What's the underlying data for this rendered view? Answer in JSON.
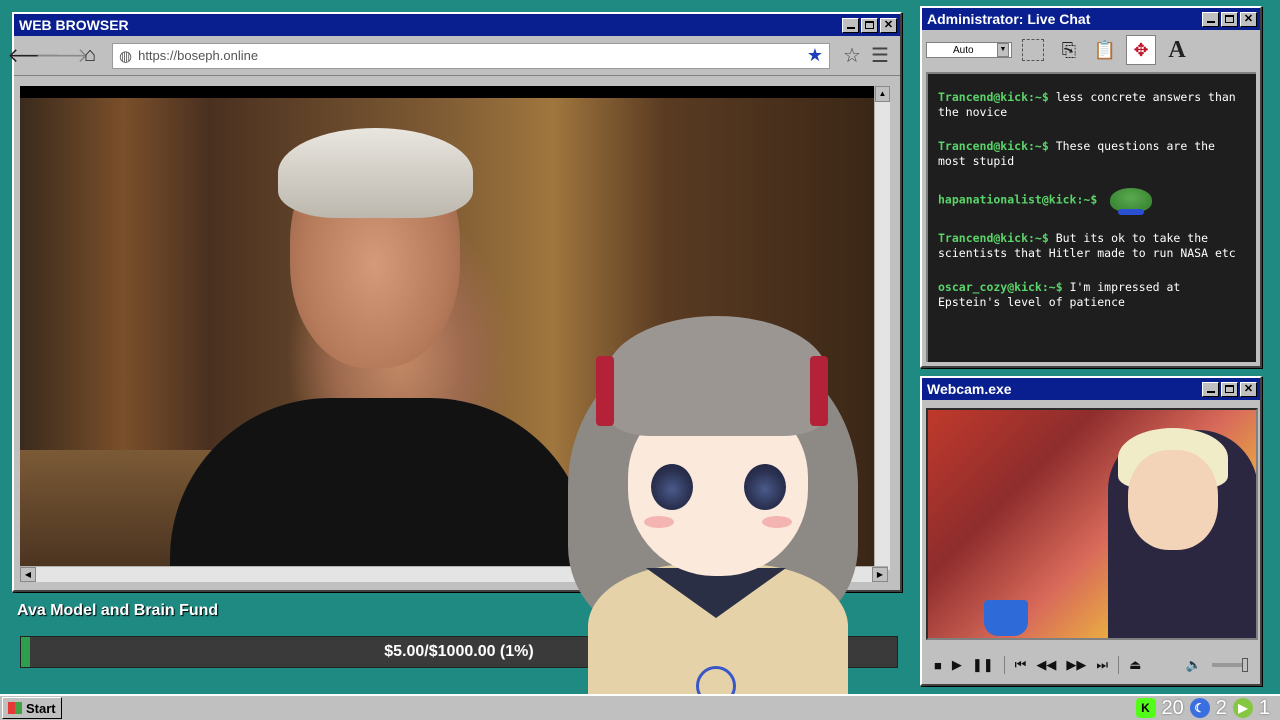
{
  "browser": {
    "title": "WEB BROWSER",
    "url": "https://boseph.online",
    "icons": {
      "back": "arrow-left-icon",
      "forward": "arrow-right-icon",
      "home": "home-icon",
      "globe": "globe-icon",
      "bookmarked": "star-filled-icon",
      "bookmark": "star-outline-icon",
      "menu": "hamburger-menu-icon"
    }
  },
  "fund": {
    "label": "Ava Model and Brain Fund",
    "progress_text": "$5.00/$1000.00 (1%)",
    "progress_fraction": 0.01,
    "fill_color": "#2f9e4f"
  },
  "chat": {
    "title": "Administrator: Live Chat",
    "font_select": "Auto",
    "messages": [
      {
        "user": "Trancend@kick:~$",
        "text": "less concrete answers than the novice"
      },
      {
        "user": "Trancend@kick:~$",
        "text": "These questions are the most stupid"
      },
      {
        "user": "hapanationalist@kick:~$",
        "text": ""
      },
      {
        "user": "Trancend@kick:~$",
        "text": "But its ok to take the scientists that Hitler made to run NASA etc"
      },
      {
        "user": "oscar_cozy@kick:~$",
        "text": "I'm impressed at Epstein's level of patience"
      }
    ],
    "user_color": "#5ad36a"
  },
  "webcam": {
    "title": "Webcam.exe"
  },
  "taskbar": {
    "start_label": "Start",
    "kick_count": "20",
    "moon_count": "2",
    "rumble_count": "1"
  },
  "colors": {
    "desktop": "#1e8a82",
    "titlebar": "#0a1f8f",
    "window": "#c0c0c0"
  }
}
